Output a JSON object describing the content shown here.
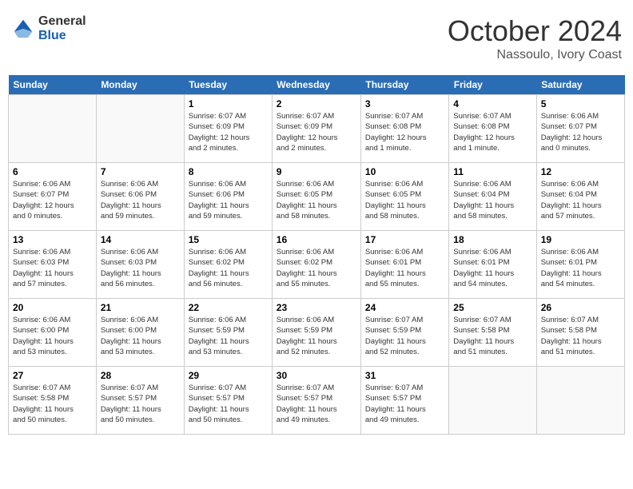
{
  "logo": {
    "general": "General",
    "blue": "Blue"
  },
  "title": "October 2024",
  "location": "Nassoulo, Ivory Coast",
  "days_of_week": [
    "Sunday",
    "Monday",
    "Tuesday",
    "Wednesday",
    "Thursday",
    "Friday",
    "Saturday"
  ],
  "weeks": [
    [
      {
        "day": "",
        "info": ""
      },
      {
        "day": "",
        "info": ""
      },
      {
        "day": "1",
        "info": "Sunrise: 6:07 AM\nSunset: 6:09 PM\nDaylight: 12 hours\nand 2 minutes."
      },
      {
        "day": "2",
        "info": "Sunrise: 6:07 AM\nSunset: 6:09 PM\nDaylight: 12 hours\nand 2 minutes."
      },
      {
        "day": "3",
        "info": "Sunrise: 6:07 AM\nSunset: 6:08 PM\nDaylight: 12 hours\nand 1 minute."
      },
      {
        "day": "4",
        "info": "Sunrise: 6:07 AM\nSunset: 6:08 PM\nDaylight: 12 hours\nand 1 minute."
      },
      {
        "day": "5",
        "info": "Sunrise: 6:06 AM\nSunset: 6:07 PM\nDaylight: 12 hours\nand 0 minutes."
      }
    ],
    [
      {
        "day": "6",
        "info": "Sunrise: 6:06 AM\nSunset: 6:07 PM\nDaylight: 12 hours\nand 0 minutes."
      },
      {
        "day": "7",
        "info": "Sunrise: 6:06 AM\nSunset: 6:06 PM\nDaylight: 11 hours\nand 59 minutes."
      },
      {
        "day": "8",
        "info": "Sunrise: 6:06 AM\nSunset: 6:06 PM\nDaylight: 11 hours\nand 59 minutes."
      },
      {
        "day": "9",
        "info": "Sunrise: 6:06 AM\nSunset: 6:05 PM\nDaylight: 11 hours\nand 58 minutes."
      },
      {
        "day": "10",
        "info": "Sunrise: 6:06 AM\nSunset: 6:05 PM\nDaylight: 11 hours\nand 58 minutes."
      },
      {
        "day": "11",
        "info": "Sunrise: 6:06 AM\nSunset: 6:04 PM\nDaylight: 11 hours\nand 58 minutes."
      },
      {
        "day": "12",
        "info": "Sunrise: 6:06 AM\nSunset: 6:04 PM\nDaylight: 11 hours\nand 57 minutes."
      }
    ],
    [
      {
        "day": "13",
        "info": "Sunrise: 6:06 AM\nSunset: 6:03 PM\nDaylight: 11 hours\nand 57 minutes."
      },
      {
        "day": "14",
        "info": "Sunrise: 6:06 AM\nSunset: 6:03 PM\nDaylight: 11 hours\nand 56 minutes."
      },
      {
        "day": "15",
        "info": "Sunrise: 6:06 AM\nSunset: 6:02 PM\nDaylight: 11 hours\nand 56 minutes."
      },
      {
        "day": "16",
        "info": "Sunrise: 6:06 AM\nSunset: 6:02 PM\nDaylight: 11 hours\nand 55 minutes."
      },
      {
        "day": "17",
        "info": "Sunrise: 6:06 AM\nSunset: 6:01 PM\nDaylight: 11 hours\nand 55 minutes."
      },
      {
        "day": "18",
        "info": "Sunrise: 6:06 AM\nSunset: 6:01 PM\nDaylight: 11 hours\nand 54 minutes."
      },
      {
        "day": "19",
        "info": "Sunrise: 6:06 AM\nSunset: 6:01 PM\nDaylight: 11 hours\nand 54 minutes."
      }
    ],
    [
      {
        "day": "20",
        "info": "Sunrise: 6:06 AM\nSunset: 6:00 PM\nDaylight: 11 hours\nand 53 minutes."
      },
      {
        "day": "21",
        "info": "Sunrise: 6:06 AM\nSunset: 6:00 PM\nDaylight: 11 hours\nand 53 minutes."
      },
      {
        "day": "22",
        "info": "Sunrise: 6:06 AM\nSunset: 5:59 PM\nDaylight: 11 hours\nand 53 minutes."
      },
      {
        "day": "23",
        "info": "Sunrise: 6:06 AM\nSunset: 5:59 PM\nDaylight: 11 hours\nand 52 minutes."
      },
      {
        "day": "24",
        "info": "Sunrise: 6:07 AM\nSunset: 5:59 PM\nDaylight: 11 hours\nand 52 minutes."
      },
      {
        "day": "25",
        "info": "Sunrise: 6:07 AM\nSunset: 5:58 PM\nDaylight: 11 hours\nand 51 minutes."
      },
      {
        "day": "26",
        "info": "Sunrise: 6:07 AM\nSunset: 5:58 PM\nDaylight: 11 hours\nand 51 minutes."
      }
    ],
    [
      {
        "day": "27",
        "info": "Sunrise: 6:07 AM\nSunset: 5:58 PM\nDaylight: 11 hours\nand 50 minutes."
      },
      {
        "day": "28",
        "info": "Sunrise: 6:07 AM\nSunset: 5:57 PM\nDaylight: 11 hours\nand 50 minutes."
      },
      {
        "day": "29",
        "info": "Sunrise: 6:07 AM\nSunset: 5:57 PM\nDaylight: 11 hours\nand 50 minutes."
      },
      {
        "day": "30",
        "info": "Sunrise: 6:07 AM\nSunset: 5:57 PM\nDaylight: 11 hours\nand 49 minutes."
      },
      {
        "day": "31",
        "info": "Sunrise: 6:07 AM\nSunset: 5:57 PM\nDaylight: 11 hours\nand 49 minutes."
      },
      {
        "day": "",
        "info": ""
      },
      {
        "day": "",
        "info": ""
      }
    ]
  ]
}
